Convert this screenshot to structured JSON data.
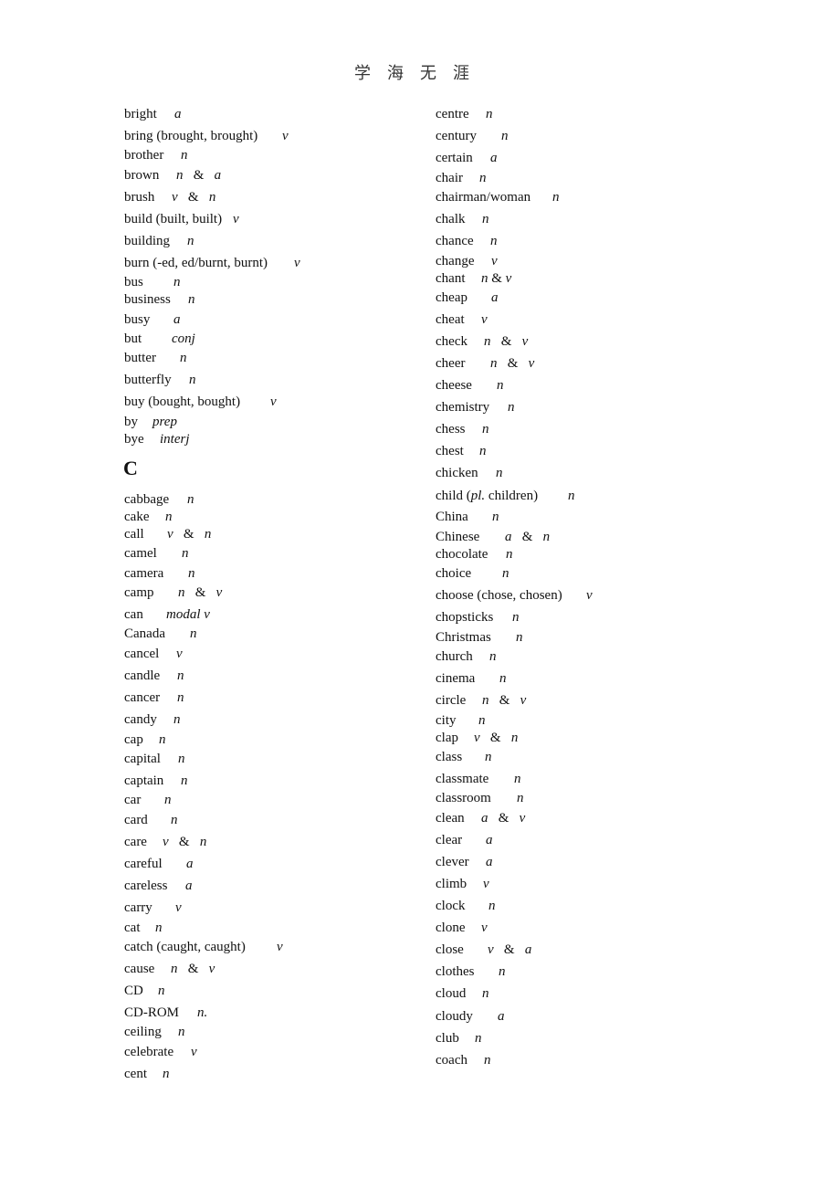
{
  "header": {
    "title": "学海无涯"
  },
  "section_letter": "C",
  "left_column": [
    {
      "word": "bright",
      "pos": "a"
    },
    {
      "word": "bring (brought, brought)",
      "pos": "v"
    },
    {
      "word": "brother",
      "pos": "n"
    },
    {
      "word": "brown",
      "pos": "n   &   a"
    },
    {
      "word": "brush",
      "pos": "v   &   n"
    },
    {
      "word": "build (built, built)",
      "pos": "v"
    },
    {
      "word": "building",
      "pos": "n"
    },
    {
      "word": "burn (-ed, ed/burnt, burnt)",
      "pos": "v"
    },
    {
      "word": "bus",
      "pos": "n"
    },
    {
      "word": "business",
      "pos": "n"
    },
    {
      "word": "busy",
      "pos": "a"
    },
    {
      "word": "but",
      "pos": "conj"
    },
    {
      "word": "butter",
      "pos": "n"
    },
    {
      "word": "butterfly",
      "pos": "n"
    },
    {
      "word": "buy (bought, bought)",
      "pos": "v"
    },
    {
      "word": "by",
      "pos": "prep"
    },
    {
      "word": "bye",
      "pos": "interj"
    },
    {
      "word": "cabbage",
      "pos": "n"
    },
    {
      "word": "cake",
      "pos": "n"
    },
    {
      "word": "call",
      "pos": "v   &   n"
    },
    {
      "word": "camel",
      "pos": "n"
    },
    {
      "word": "camera",
      "pos": "n"
    },
    {
      "word": "camp",
      "pos": "n   &   v"
    },
    {
      "word": "can",
      "pos": "modal v"
    },
    {
      "word": "Canada",
      "pos": "n"
    },
    {
      "word": "cancel",
      "pos": "v"
    },
    {
      "word": "candle",
      "pos": "n"
    },
    {
      "word": "cancer",
      "pos": "n"
    },
    {
      "word": "candy",
      "pos": "n"
    },
    {
      "word": "cap",
      "pos": "n"
    },
    {
      "word": "capital",
      "pos": "n"
    },
    {
      "word": "captain",
      "pos": "n"
    },
    {
      "word": "car",
      "pos": "n"
    },
    {
      "word": "card",
      "pos": "n"
    },
    {
      "word": "care",
      "pos": "v   &   n"
    },
    {
      "word": "careful",
      "pos": "a"
    },
    {
      "word": "careless",
      "pos": "a"
    },
    {
      "word": "carry",
      "pos": "v"
    },
    {
      "word": "cat",
      "pos": "n"
    },
    {
      "word": "catch (caught, caught)",
      "pos": "v"
    },
    {
      "word": "cause",
      "pos": "n   &   v"
    },
    {
      "word": "CD",
      "pos": "n"
    },
    {
      "word": "CD-ROM",
      "pos": "n."
    },
    {
      "word": "ceiling",
      "pos": "n"
    },
    {
      "word": "celebrate",
      "pos": "v"
    },
    {
      "word": "cent",
      "pos": "n"
    }
  ],
  "right_column": [
    {
      "word": "centre",
      "pos": "n"
    },
    {
      "word": "century",
      "pos": "n"
    },
    {
      "word": "certain",
      "pos": "a"
    },
    {
      "word": "chair",
      "pos": "n"
    },
    {
      "word": "chairman/woman",
      "pos": "n"
    },
    {
      "word": "chalk",
      "pos": "n"
    },
    {
      "word": "chance",
      "pos": "n"
    },
    {
      "word": "change",
      "pos": "v"
    },
    {
      "word": "chant",
      "pos": "n & v"
    },
    {
      "word": "cheap",
      "pos": "a"
    },
    {
      "word": "cheat",
      "pos": "v"
    },
    {
      "word": "check",
      "pos": "n   &   v"
    },
    {
      "word": "cheer",
      "pos": "n   &   v"
    },
    {
      "word": "cheese",
      "pos": "n"
    },
    {
      "word": "chemistry",
      "pos": "n"
    },
    {
      "word": "chess",
      "pos": "n"
    },
    {
      "word": "chest",
      "pos": "n"
    },
    {
      "word": "chicken",
      "pos": "n"
    },
    {
      "word": "child (",
      "word_italic": "pl.",
      "word_rest": " children)",
      "pos": "n"
    },
    {
      "word": "China",
      "pos": "n"
    },
    {
      "word": "Chinese",
      "pos": "a   &   n"
    },
    {
      "word": "chocolate",
      "pos": "n"
    },
    {
      "word": "choice",
      "pos": "n"
    },
    {
      "word": "choose (chose, chosen)",
      "pos": "v"
    },
    {
      "word": "chopsticks",
      "pos": "n"
    },
    {
      "word": "Christmas",
      "pos": "n"
    },
    {
      "word": "church",
      "pos": "n"
    },
    {
      "word": "cinema",
      "pos": "n"
    },
    {
      "word": "circle",
      "pos": "n   &   v"
    },
    {
      "word": "city",
      "pos": "n"
    },
    {
      "word": "clap",
      "pos": "v   &   n"
    },
    {
      "word": "class",
      "pos": "n"
    },
    {
      "word": "classmate",
      "pos": "n"
    },
    {
      "word": "classroom",
      "pos": "n"
    },
    {
      "word": "clean",
      "pos": "a   &   v"
    },
    {
      "word": "clear",
      "pos": "a"
    },
    {
      "word": "clever",
      "pos": "a"
    },
    {
      "word": "climb",
      "pos": "v"
    },
    {
      "word": "clock",
      "pos": "n"
    },
    {
      "word": "clone",
      "pos": "v"
    },
    {
      "word": "close",
      "pos": "v   &   a"
    },
    {
      "word": "clothes",
      "pos": "n"
    },
    {
      "word": "cloud",
      "pos": "n"
    },
    {
      "word": "cloudy",
      "pos": "a"
    },
    {
      "word": "club",
      "pos": "n"
    },
    {
      "word": "coach",
      "pos": "n"
    }
  ]
}
